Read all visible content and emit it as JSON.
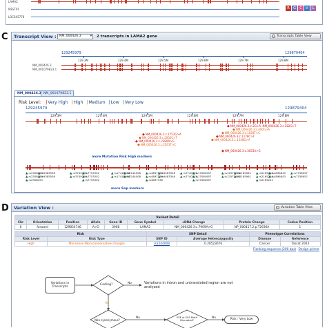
{
  "top_tracks": {
    "names": [
      "LAMA2",
      "MESTP1",
      "LOC645778"
    ],
    "color_buttons": [
      {
        "label": "R",
        "color": "#c0392b"
      },
      {
        "label": "G",
        "color": "#7b6fb0"
      },
      {
        "label": "C",
        "color": "#d35a9a"
      },
      {
        "label": "V",
        "color": "#3f7fbf"
      },
      {
        "label": "L",
        "color": "#a36bb6"
      }
    ]
  },
  "section_c": {
    "letter": "C",
    "title": "Transcript View :",
    "transcript_select": "NM_000426.3",
    "summary": "2 transcripts in LAMA2 gene",
    "table_button": "Transcripts Table View",
    "coord_start": "129245979",
    "coord_end": "129879404",
    "ticks": [
      "129.3M",
      "129.4M",
      "129.5M",
      "129.6M",
      "129.7M",
      "129.8M"
    ],
    "transcripts": [
      "NM_000426.3",
      "NM_001079823.1"
    ],
    "tabs": [
      "NM_000426.3",
      "NM_001079823.1"
    ],
    "risk_label": "Risk Level:",
    "risk_levels": [
      {
        "label": "Very High",
        "color": "#d21a1a"
      },
      {
        "label": "High",
        "color": "#e0621d"
      },
      {
        "label": "Medium",
        "color": "#c9a21b"
      },
      {
        "label": "Low",
        "color": "#3b6fd1"
      },
      {
        "label": "Very Low",
        "color": "#1f9a3a"
      }
    ],
    "mutation_labels": [
      "NM_000426.3:c.2G>A, NM_000426.3:c.282G>T",
      "NM_000426.3:c.400G>A",
      "NM_000426.3:c.1028T>C",
      "NM_000426.3:c.1178C>T",
      "NM_000426.3:c.1548G>A",
      "NM_000426.3:c.1753G>A",
      "NM_000426.3:c.2000C>T",
      "NM_000426.3:c.2380A>G",
      "NM_000426.3:c.2561T>C",
      "NM_000426.3:c.3053A>G"
    ],
    "more_mutation": "more Mutation Risk High markers",
    "snp_labels": [
      "rs2308053",
      "rs3749795",
      "rs17416939",
      "rs4897336",
      "rs7740071",
      "rs12573974",
      "rs2165241",
      "rs7758957",
      "rs9385558",
      "rs7753302",
      "rs2244008",
      "rs9483346",
      "rs17080957",
      "rs2185981",
      "rs4896843"
    ],
    "more_snp": "more Snp markers"
  },
  "section_d": {
    "letter": "D",
    "title": "Variation View :",
    "table_button": "Variation Table View",
    "variant_header": "Variant Detail",
    "variant_cols": [
      "Chr",
      "Orientation",
      "Position",
      "Allele",
      "Gene ID",
      "Gene Symbol",
      "cDNA Change",
      "Protein Change",
      "Codon Position"
    ],
    "variant_row": [
      "6",
      "forward",
      "129854746",
      "A>G",
      "3908",
      "LAMA2",
      "NM_000426.3:c.7909A>G",
      "NP_000417.2:p.T2636A",
      "1"
    ],
    "risk_header": "Risk",
    "snp_header": "SNP Detail",
    "pheno_header": "Phenotype Correlations",
    "risk_cols": [
      "Risk Level",
      "Risk Type",
      "SNP ID",
      "Average Heterozygosity",
      "Disease",
      "Reference"
    ],
    "risk_row": [
      "High",
      "Mis-sense (Non-conservative change)",
      "rs2244008",
      "0.20523676",
      "Cancer",
      "Tassat 2003"
    ],
    "links": [
      "Flanking sequence (200 bps)",
      "Design primer"
    ],
    "flow": {
      "start": "Variations in Transcripts",
      "coding": "Coding?",
      "no": "No",
      "yes": "Yes",
      "intron_note": "Variations in intron and untranslated region are not analyzed",
      "nonsyn": "Non-synonymous?",
      "ese": "ESE or ESS Motif Disrupted?",
      "result": "Risk : Very Low"
    }
  }
}
